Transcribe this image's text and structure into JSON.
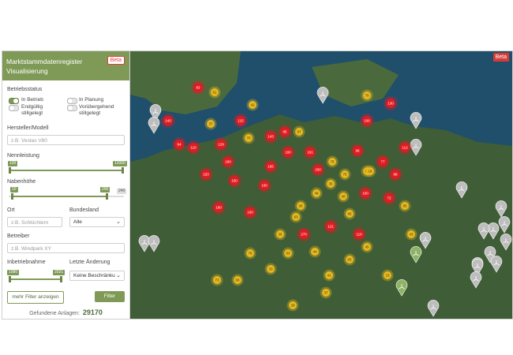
{
  "header": {
    "title_line1": "Marktstammdatenregister",
    "title_line2": "Visualisierung",
    "beta": "Beta"
  },
  "status": {
    "label": "Betriebsstatus",
    "items": [
      {
        "label": "In Betrieb",
        "on": true
      },
      {
        "label": "In Planung",
        "on": false
      },
      {
        "label": "Endgültig stillgelegt",
        "on": false
      },
      {
        "label": "Vorübergehend stillgelegt",
        "on": false
      }
    ]
  },
  "hersteller": {
    "label": "Hersteller/Modell",
    "placeholder": "z.B. Vestas V80"
  },
  "nennleistung": {
    "label": "Nennleistung",
    "min": "100",
    "max": "12000"
  },
  "nabenhoehe": {
    "label": "Nabenhöhe",
    "min": "10",
    "max": "200",
    "limit": "240"
  },
  "ort": {
    "label": "Ort",
    "placeholder": "z.B. Schlüchtern"
  },
  "bundesland": {
    "label": "Bundesland",
    "value": "Alle"
  },
  "betreiber": {
    "label": "Betreiber",
    "placeholder": "z.B. Windpark XY"
  },
  "inbetriebnahme": {
    "label": "Inbetriebnahme",
    "min": "1980",
    "max": "2021"
  },
  "letzte_aenderung": {
    "label": "Letzte Änderung",
    "value": "Keine Beschränkung"
  },
  "buttons": {
    "more": "mehr Filter anzeigen",
    "filter": "Filter"
  },
  "found": {
    "label": "Gefundene Anlagen:",
    "count": "29170"
  },
  "map": {
    "beta": "Beta",
    "colors": {
      "sea": "#1f4f6b",
      "land": "#3f5d36",
      "red": "#e21b22",
      "yellow": "#e8b91d",
      "green": "#8fb365"
    },
    "clusters": [
      {
        "label": "83",
        "color": "red"
      },
      {
        "label": "61",
        "color": "yellow"
      },
      {
        "label": "70",
        "color": "yellow"
      },
      {
        "label": "130",
        "color": "red"
      },
      {
        "label": "140",
        "color": "red"
      },
      {
        "label": "37",
        "color": "yellow"
      },
      {
        "label": "42",
        "color": "yellow"
      },
      {
        "label": "115",
        "color": "red"
      },
      {
        "label": "143",
        "color": "red"
      },
      {
        "label": "160",
        "color": "red"
      },
      {
        "label": "191",
        "color": "red"
      },
      {
        "label": "75",
        "color": "yellow"
      },
      {
        "label": "96",
        "color": "red"
      },
      {
        "label": "77",
        "color": "red"
      },
      {
        "label": "112",
        "color": "red"
      },
      {
        "label": "106",
        "color": "red"
      },
      {
        "label": "85",
        "color": "red"
      },
      {
        "label": "97",
        "color": "yellow"
      },
      {
        "label": "94",
        "color": "red"
      },
      {
        "label": "110",
        "color": "red"
      },
      {
        "label": "129",
        "color": "red"
      },
      {
        "label": "70",
        "color": "yellow"
      },
      {
        "label": "165",
        "color": "red"
      },
      {
        "label": "75",
        "color": "yellow"
      },
      {
        "label": "85",
        "color": "yellow"
      },
      {
        "label": "88",
        "color": "red"
      },
      {
        "label": "180",
        "color": "red"
      },
      {
        "label": "95",
        "color": "yellow"
      },
      {
        "label": "48",
        "color": "yellow"
      },
      {
        "label": "35",
        "color": "yellow"
      },
      {
        "label": "40",
        "color": "yellow"
      },
      {
        "label": "100",
        "color": "red"
      },
      {
        "label": "72",
        "color": "red"
      },
      {
        "label": "220",
        "color": "red"
      },
      {
        "label": "150",
        "color": "red"
      },
      {
        "label": "160",
        "color": "red"
      },
      {
        "label": "200",
        "color": "red"
      },
      {
        "label": "95",
        "color": "yellow"
      },
      {
        "label": "43",
        "color": "yellow"
      },
      {
        "label": "18",
        "color": "yellow"
      },
      {
        "label": "63",
        "color": "yellow"
      },
      {
        "label": "35",
        "color": "yellow"
      },
      {
        "label": "160",
        "color": "red"
      },
      {
        "label": "180",
        "color": "red"
      },
      {
        "label": "270",
        "color": "red"
      },
      {
        "label": "121",
        "color": "red"
      },
      {
        "label": "110",
        "color": "red"
      },
      {
        "label": "85",
        "color": "yellow"
      },
      {
        "label": "73",
        "color": "yellow"
      },
      {
        "label": "66",
        "color": "yellow"
      },
      {
        "label": "79",
        "color": "yellow"
      },
      {
        "label": "33",
        "color": "yellow"
      },
      {
        "label": "53",
        "color": "yellow"
      },
      {
        "label": "44",
        "color": "yellow"
      },
      {
        "label": "41",
        "color": "yellow"
      },
      {
        "label": "65",
        "color": "yellow"
      },
      {
        "label": "28",
        "color": "yellow"
      },
      {
        "label": "37",
        "color": "yellow"
      },
      {
        "label": "45",
        "color": "yellow"
      },
      {
        "label": "23",
        "color": "yellow"
      }
    ],
    "turbines": {
      "grey_count": 20,
      "green_count": 2
    }
  }
}
